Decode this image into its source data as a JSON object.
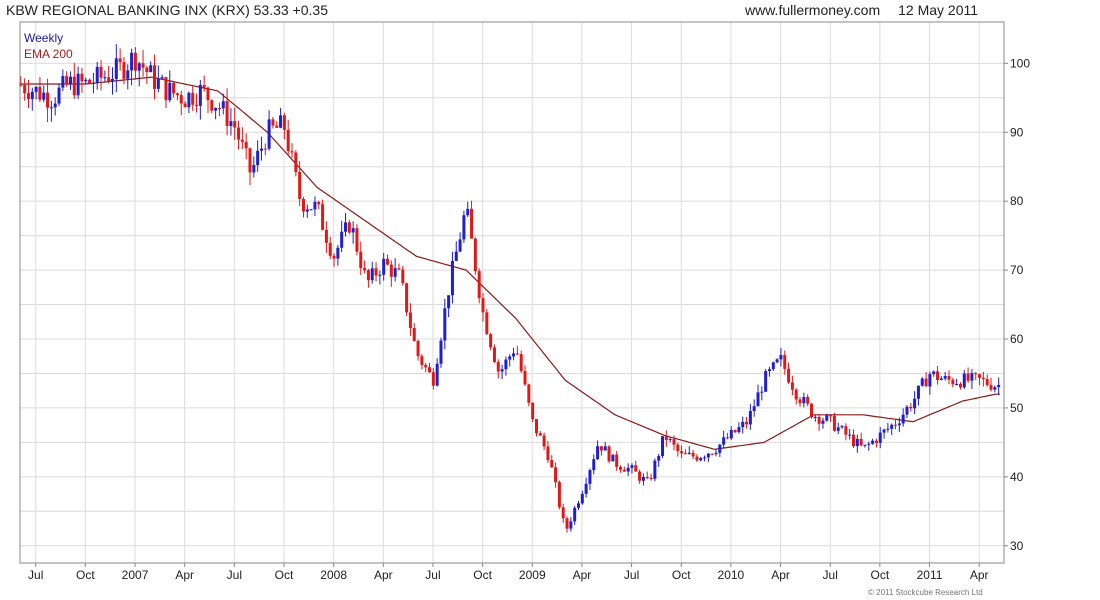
{
  "header": {
    "title": "KBW REGIONAL BANKING INX (KRX) 53.33 +0.35",
    "site": "www.fullermoney.com",
    "date": "12 May 2011"
  },
  "legend": {
    "series1": "Weekly",
    "series2": "EMA 200"
  },
  "footer": {
    "copyright": "© 2011 Stockcube Research Ltd"
  },
  "colors": {
    "up": "#1f1fd0",
    "down": "#e01818",
    "ema": "#8b1a1a",
    "grid": "#dcdcdc",
    "frame": "#888888"
  },
  "chart_data": {
    "type": "line",
    "series": [
      {
        "name": "Weekly",
        "style": "candlestick",
        "keypoints_x": [
          "2006-06",
          "2006-07",
          "2006-08",
          "2006-09",
          "2006-10",
          "2006-11",
          "2006-12",
          "2007-01",
          "2007-02",
          "2007-03",
          "2007-04",
          "2007-05",
          "2007-06",
          "2007-07",
          "2007-08",
          "2007-09",
          "2007-10",
          "2007-11",
          "2007-12",
          "2008-01",
          "2008-02",
          "2008-03",
          "2008-04",
          "2008-05",
          "2008-06",
          "2008-07",
          "2008-08",
          "2008-09",
          "2008-10",
          "2008-11",
          "2008-12",
          "2009-01",
          "2009-02",
          "2009-03",
          "2009-04",
          "2009-05",
          "2009-06",
          "2009-07",
          "2009-08",
          "2009-09",
          "2009-10",
          "2009-11",
          "2009-12",
          "2010-01",
          "2010-02",
          "2010-03",
          "2010-04",
          "2010-05",
          "2010-06",
          "2010-07",
          "2010-08",
          "2010-09",
          "2010-10",
          "2010-11",
          "2010-12",
          "2011-01",
          "2011-02",
          "2011-03",
          "2011-04",
          "2011-05"
        ],
        "keypoints_y": [
          97,
          96,
          95,
          97,
          97,
          98,
          99,
          101,
          98,
          96,
          95,
          96,
          94,
          91,
          84,
          90,
          91,
          80,
          79,
          72,
          77,
          68,
          71,
          69,
          58,
          54,
          68,
          79,
          64,
          55,
          59,
          48,
          43,
          32,
          38,
          45,
          42,
          41,
          39,
          46,
          43,
          43,
          44,
          46,
          48,
          54,
          57,
          52,
          49,
          48,
          46,
          44,
          46,
          48,
          51,
          55,
          54,
          54,
          54,
          53.3
        ]
      },
      {
        "name": "EMA 200",
        "keypoints_x": [
          "2006-06",
          "2006-10",
          "2007-02",
          "2007-06",
          "2007-09",
          "2007-12",
          "2008-03",
          "2008-06",
          "2008-09",
          "2008-12",
          "2009-03",
          "2009-06",
          "2009-09",
          "2009-12",
          "2010-03",
          "2010-06",
          "2010-09",
          "2010-12",
          "2011-03",
          "2011-05"
        ],
        "keypoints_y": [
          97,
          97,
          98,
          96,
          90,
          82,
          77,
          72,
          70,
          63,
          54,
          49,
          46,
          44,
          45,
          49,
          49,
          48,
          51,
          52
        ]
      }
    ],
    "x_tick_labels": [
      "Jul",
      "Oct",
      "2007",
      "Apr",
      "Jul",
      "Oct",
      "2008",
      "Apr",
      "Jul",
      "Oct",
      "2009",
      "Apr",
      "Jul",
      "Oct",
      "2010",
      "Apr",
      "Jul",
      "Oct",
      "2011",
      "Apr"
    ],
    "y_tick_labels": [
      "30",
      "40",
      "50",
      "60",
      "70",
      "80",
      "90",
      "100"
    ],
    "ylim": [
      27.5,
      106
    ],
    "xlim": [
      "2006-06",
      "2011-05"
    ],
    "y_axis_side": "right",
    "grid": true,
    "legend_position": "top-left"
  }
}
